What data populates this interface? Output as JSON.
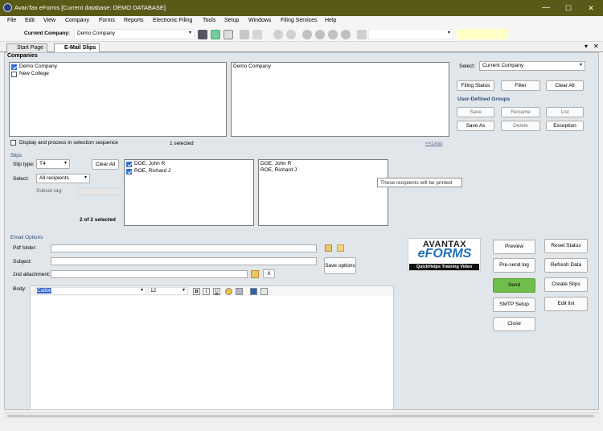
{
  "window": {
    "title": "AvanTax eForms [Current database: DEMO DATABASE]",
    "min": "—",
    "max": "☐",
    "close": "✕"
  },
  "menu": [
    "File",
    "Edit",
    "View",
    "Company",
    "Forms",
    "Reports",
    "Electronic Filing",
    "Tools",
    "Setup",
    "Windows",
    "Filing Services",
    "Help"
  ],
  "toolbar": {
    "company_label": "Current Company:",
    "company_value": "Demo Company"
  },
  "tabs": [
    {
      "label": "Start Page"
    },
    {
      "label": "E-Mail Slips"
    }
  ],
  "doc_controls": {
    "restore": "▾",
    "close": "✕"
  },
  "companies": {
    "title": "Companies",
    "list": [
      {
        "name": "Demo Company",
        "checked": true
      },
      {
        "name": "New College",
        "checked": false
      }
    ],
    "selected_list": [
      "Demo Company"
    ],
    "sequence_label": "Display and process in selection sequence",
    "selected_count": "1 selected",
    "less_link": "<<Less"
  },
  "select_panel": {
    "select_label": "Select:",
    "select_value": "Current Company",
    "filing_status": "Filing Status",
    "filter": "Filter",
    "clear_all": "Clear All",
    "groups_title": "User-Defined Groups",
    "save": "Save",
    "rename": "Rename",
    "list": "List",
    "save_as": "Save As",
    "delete": "Delete",
    "exception": "Exception"
  },
  "slips": {
    "title": "Slips",
    "slip_type_label": "Slip type:",
    "slip_type_value": "T4",
    "clear_all": "Clear All",
    "select_label": "Select:",
    "select_value": "All recipients",
    "subset_label": "Subset tag:",
    "count": "2 of 2 selected",
    "recipients": [
      {
        "name": "DOE, John R",
        "checked": true
      },
      {
        "name": "ROE, Richard J",
        "checked": true
      }
    ],
    "printed": [
      "DOE, John R",
      "ROE, Richard J"
    ],
    "tooltip": "These recipients will be printed"
  },
  "email": {
    "title": "Email Options",
    "pdf_folder_label": "Pdf folder:",
    "subject_label": "Subject:",
    "attachment_label": "2nd attachment:",
    "clear_x": "X",
    "save_options": "Save options",
    "body_label": "Body:",
    "font_value": "Calibri",
    "size_value": "12",
    "bold": "B",
    "italic": "I",
    "underline": "U"
  },
  "promo": {
    "brand_top": "AVANTAX",
    "brand_main": "eFORMS",
    "caption": "QuickHelps Training Video"
  },
  "actions": {
    "preview": "Preview",
    "reset_status": "Reset Status",
    "presend_log": "Pre-send log",
    "refresh_data": "Refresh Data",
    "send": "Send",
    "create_slips": "Create Slips",
    "smtp_setup": "SMTP Setup",
    "edit_list": "Edit list",
    "close": "Close"
  },
  "colors": {
    "titlebar": "#5a5a18",
    "panel": "#e1e6ea",
    "send": "#6fbf4a",
    "check": "#2f6fd1"
  }
}
